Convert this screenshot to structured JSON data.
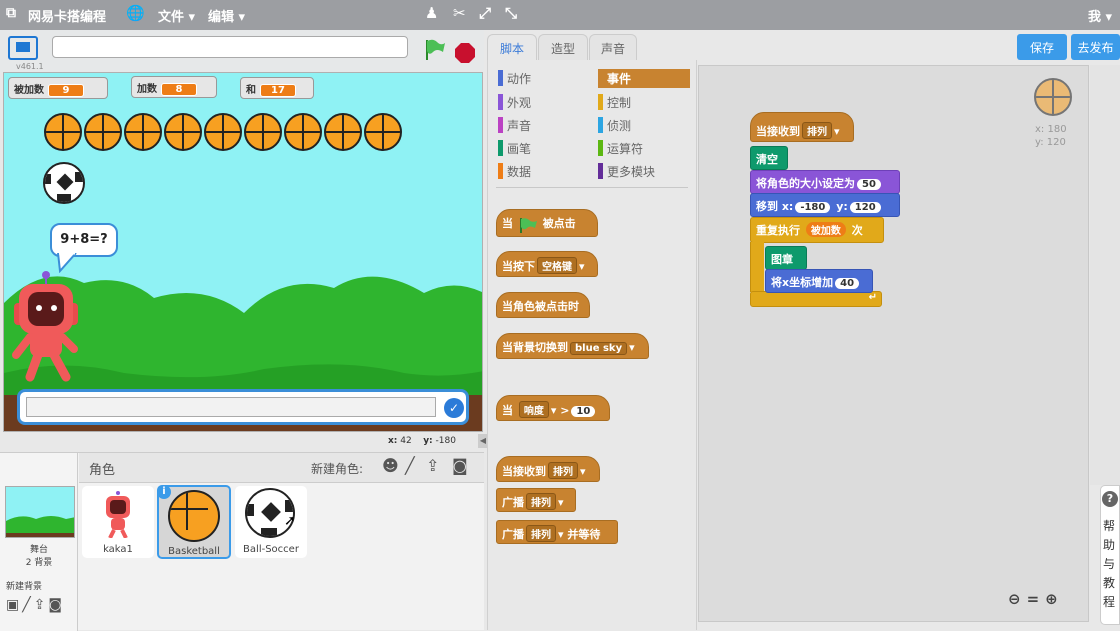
{
  "menu": {
    "app_name": "网易卡搭编程",
    "file": "文件",
    "edit": "编辑",
    "user": "我"
  },
  "stage": {
    "version": "v461.1",
    "monitors": [
      {
        "label": "被加数",
        "value": "9"
      },
      {
        "label": "加数",
        "value": "8"
      },
      {
        "label": "和",
        "value": "17"
      }
    ],
    "speech": "9+8=?",
    "coords": {
      "x_label": "x:",
      "x": "42",
      "y_label": "y:",
      "y": "-180"
    },
    "answer_input": {
      "value": ""
    },
    "url_input": {
      "value": ""
    }
  },
  "sprites_panel": {
    "title": "角色",
    "new_sprite": "新建角色:",
    "stage_label": "舞台",
    "stage_backdrops": "2 背景",
    "new_backdrop": "新建背景",
    "sprites": [
      {
        "name": "kaka1"
      },
      {
        "name": "Basketball"
      },
      {
        "name": "Ball-Soccer"
      }
    ]
  },
  "tabs": {
    "scripts": "脚本",
    "costumes": "造型",
    "sounds": "声音"
  },
  "buttons": {
    "save": "保存",
    "publish": "去发布"
  },
  "categories": [
    {
      "label": "动作",
      "color": "#4a6cd4"
    },
    {
      "label": "外观",
      "color": "#8a55d7"
    },
    {
      "label": "声音",
      "color": "#bb42c3"
    },
    {
      "label": "画笔",
      "color": "#0e9a6c"
    },
    {
      "label": "数据",
      "color": "#ee7d16"
    },
    {
      "label": "事件",
      "color": "#c88330"
    },
    {
      "label": "控制",
      "color": "#e1a91a"
    },
    {
      "label": "侦测",
      "color": "#2ca5e2"
    },
    {
      "label": "运算符",
      "color": "#5cb712"
    },
    {
      "label": "更多模块",
      "color": "#632d99"
    }
  ],
  "palette_blocks": {
    "flag_when": "当",
    "flag_clicked": "被点击",
    "key_pressed": "当按下",
    "key_value": "空格键",
    "sprite_clicked": "当角色被点击时",
    "backdrop_switch": "当背景切换到",
    "backdrop_value": "blue sky",
    "sensor_when": "当",
    "sensor_value": "响度",
    "sensor_op": ">",
    "sensor_num": "10",
    "receive": "当接收到",
    "receive_value": "排列",
    "broadcast": "广播",
    "broadcast_value": "排列",
    "broadcast_wait": "广播",
    "broadcast_wait_value": "排列",
    "broadcast_wait_suffix": "并等待"
  },
  "script": {
    "hat": "当接收到",
    "hat_value": "排列",
    "clear": "清空",
    "set_size": "将角色的大小设定为",
    "set_size_value": "50",
    "goto": "移到 x:",
    "goto_x": "-180",
    "goto_y_label": "y:",
    "goto_y": "120",
    "repeat": "重复执行",
    "repeat_var": "被加数",
    "repeat_suffix": "次",
    "stamp": "图章",
    "change_x": "将x坐标增加",
    "change_x_value": "40"
  },
  "sprite_info": {
    "x_label": "x:",
    "x": "180",
    "y_label": "y:",
    "y": "120"
  },
  "help": {
    "label": "帮助与教程"
  }
}
